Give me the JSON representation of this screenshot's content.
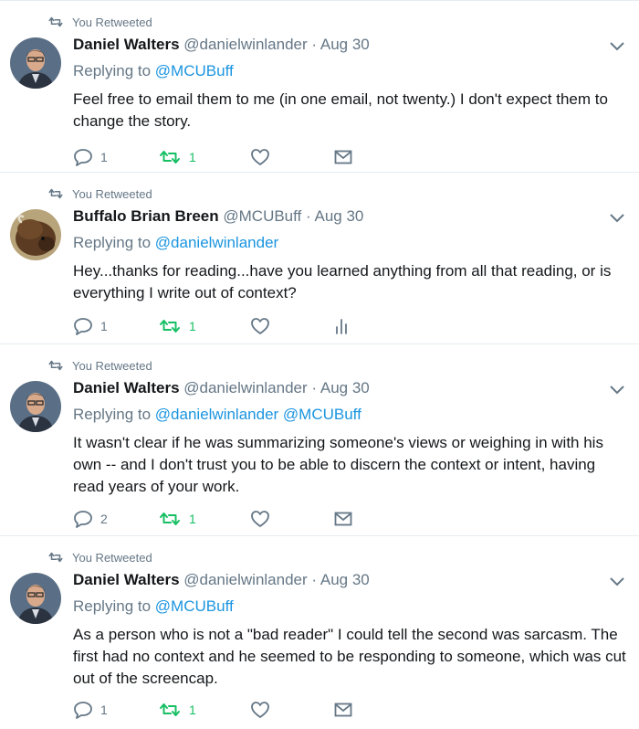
{
  "tweets": [
    {
      "retweet_label": "You Retweeted",
      "name": "Daniel Walters",
      "handle": "@danielwinlander",
      "dot": "·",
      "date": "Aug 30",
      "replying_prefix": "Replying to",
      "replying_to": "@MCUBuff",
      "text": "Feel free to email them to me (in one email, not twenty.) I don't expect them to change the story.",
      "replies": "1",
      "retweets": "1",
      "last_action_icon": "envelope-icon"
    },
    {
      "retweet_label": "You Retweeted",
      "name": "Buffalo Brian Breen",
      "handle": "@MCUBuff",
      "dot": "·",
      "date": "Aug 30",
      "replying_prefix": "Replying to",
      "replying_to": "@danielwinlander",
      "text": "Hey...thanks for reading...have you learned anything from all that reading, or is everything I write out of context?",
      "replies": "1",
      "retweets": "1",
      "last_action_icon": "analytics-icon"
    },
    {
      "retweet_label": "You Retweeted",
      "name": "Daniel Walters",
      "handle": "@danielwinlander",
      "dot": "·",
      "date": "Aug 30",
      "replying_prefix": "Replying to",
      "replying_to": "@danielwinlander @MCUBuff",
      "text": "It wasn't clear if he was summarizing someone's views or weighing in with his own -- and I don't trust you to be able to discern the context or intent, having read years of your work.",
      "replies": "2",
      "retweets": "1",
      "last_action_icon": "envelope-icon"
    },
    {
      "retweet_label": "You Retweeted",
      "name": "Daniel Walters",
      "handle": "@danielwinlander",
      "dot": "·",
      "date": "Aug 30",
      "replying_prefix": "Replying to",
      "replying_to": "@MCUBuff",
      "text": "As a person who is not a \"bad reader\" I could tell the second was sarcasm. The first had no context and he seemed to be responding to someone, which was cut out of the screencap.",
      "replies": "1",
      "retweets": "1",
      "last_action_icon": "envelope-icon"
    }
  ],
  "colors": {
    "retweeted_green": "#17bf63",
    "link_blue": "#1b95e0",
    "secondary_gray": "#657786",
    "divider": "#e6ecf0"
  }
}
